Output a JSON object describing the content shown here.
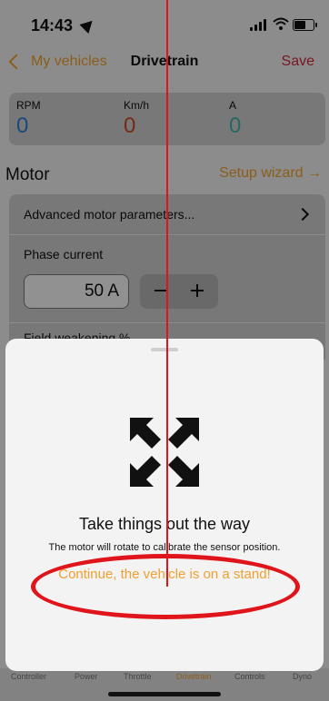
{
  "status_bar": {
    "time": "14:43"
  },
  "nav": {
    "back_label": "My vehicles",
    "title": "Drivetrain",
    "save_label": "Save"
  },
  "metrics": [
    {
      "label": "RPM",
      "value": "0",
      "color": "#2f7fd6"
    },
    {
      "label": "Km/h",
      "value": "0",
      "color": "#c84a22"
    },
    {
      "label": "A",
      "value": "0",
      "color": "#43b5a5"
    }
  ],
  "motor": {
    "title": "Motor",
    "wizard_label": "Setup wizard →",
    "advanced_label": "Advanced motor parameters...",
    "phase_current_label": "Phase current",
    "phase_current_value": "50 A",
    "field_weakening_label": "Field weakening %"
  },
  "tabs": [
    "Controller",
    "Power",
    "Throttle",
    "Drivetrain",
    "Controls",
    "Dyno"
  ],
  "active_tab": "Drivetrain",
  "sheet": {
    "title": "Take things out the way",
    "description": "The motor will rotate to calibrate the sensor position.",
    "continue_label": "Continue, the vehicle is on a stand!"
  },
  "colors": {
    "accent": "#f0a030",
    "save": "#d02a3a",
    "annotation": "#e0151c"
  }
}
